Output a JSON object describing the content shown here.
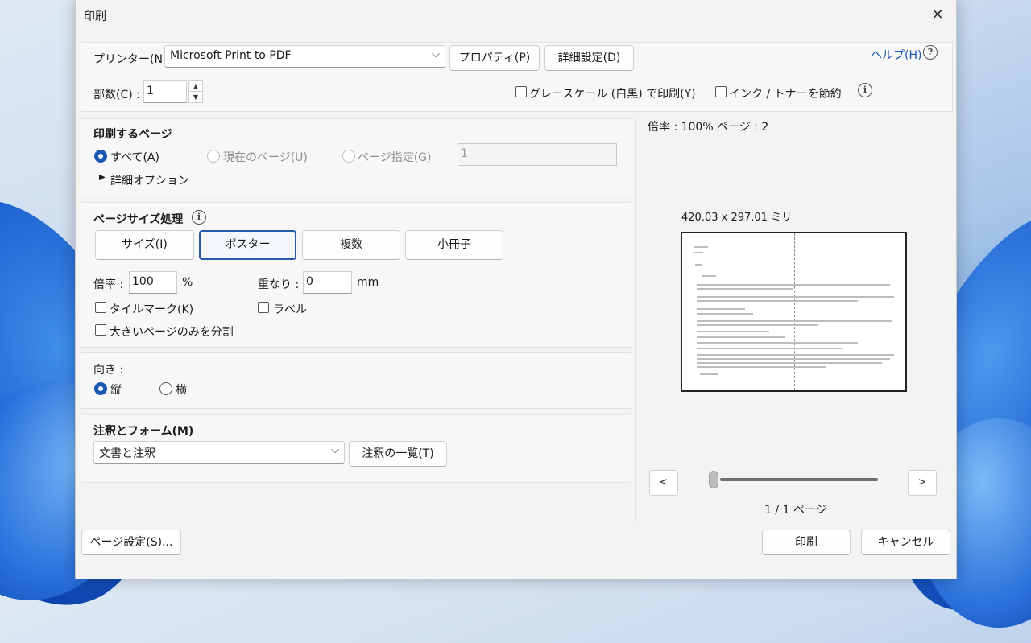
{
  "dialog": {
    "title": "印刷",
    "close_glyph": "✕"
  },
  "top": {
    "printer_label": "プリンター(N) :",
    "printer_value": "Microsoft Print to PDF",
    "properties_button": "プロパティ(P)",
    "advanced_button": "詳細設定(D)",
    "help_link": "ヘルプ(H)",
    "help_glyph": "?",
    "copies_label": "部数(C) :",
    "copies_value": "1",
    "grayscale_label": "グレースケール (白黒) で印刷(Y)",
    "ink_save_label": "インク / トナーを節約",
    "info_glyph": "i"
  },
  "pages": {
    "heading": "印刷するページ",
    "all_label": "すべて(A)",
    "current_label": "現在のページ(U)",
    "range_label": "ページ指定(G)",
    "range_value": "1",
    "more_options_label": "詳細オプション",
    "more_options_arrow": "▶"
  },
  "page_size": {
    "heading": "ページサイズ処理",
    "buttons": [
      "サイズ(I)",
      "ポスター",
      "複数",
      "小冊子"
    ],
    "selected": "ポスター",
    "scale_label": "倍率 :",
    "scale_value": "100",
    "scale_unit": "%",
    "overlap_label": "重なり :",
    "overlap_value": "0",
    "overlap_unit": "mm",
    "tile_marks_label": "タイルマーク(K)",
    "labels_label": "ラベル",
    "split_large_label": "大きいページのみを分割"
  },
  "orientation": {
    "heading": "向き :",
    "portrait_label": "縦",
    "landscape_label": "横",
    "selected": "portrait"
  },
  "annotations": {
    "heading": "注釈とフォーム(M)",
    "select_value": "文書と注釈",
    "list_button": "注釈の一覧(T)"
  },
  "preview": {
    "scale_info": "倍率 : 100% ページ : 2",
    "paper_size": "420.03 x 297.01 ミリ",
    "prev_glyph": "<",
    "next_glyph": ">",
    "page_counter": "1 / 1 ページ",
    "slider_position": 0
  },
  "footer": {
    "page_setup_button": "ページ設定(S)...",
    "print_button": "印刷",
    "cancel_button": "キャンセル"
  },
  "colors": {
    "accent": "#1d57b4",
    "selected_border": "#2a5bab"
  },
  "icons": [
    "close-icon",
    "chevron-down-icon",
    "help-icon",
    "info-icon",
    "expand-arrow-icon"
  ]
}
